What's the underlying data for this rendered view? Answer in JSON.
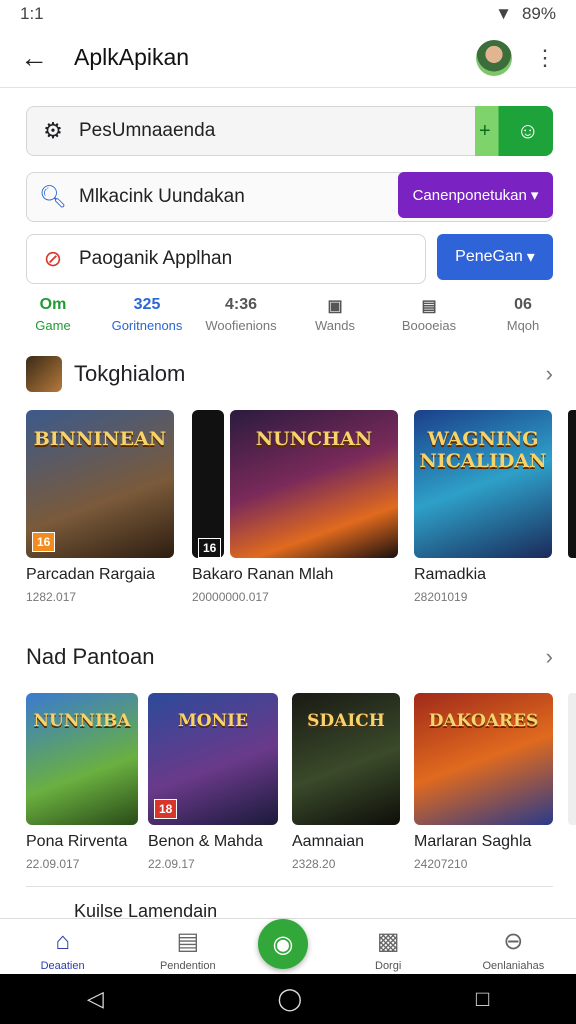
{
  "status_bar": {
    "time": "1:1",
    "battery": "89%"
  },
  "app_bar": {
    "title": "AplkApikan"
  },
  "search_rows": [
    {
      "text": "PesUmnaaenda",
      "icon": "gear-icon"
    },
    {
      "text": "Mlkacink Uundakan",
      "icon": "search-icon"
    },
    {
      "text": "Paoganik Applhan",
      "icon": "no-entry-icon"
    }
  ],
  "buttons": {
    "purple_label": "Canenponetukan",
    "blue_label": "PeneGan"
  },
  "stats": [
    {
      "value": "Om",
      "label": "Game"
    },
    {
      "value": "325",
      "label": "Goritnenons"
    },
    {
      "value": "4:36",
      "label": "Woofienions"
    },
    {
      "value": "",
      "label": "Wands"
    },
    {
      "value": "",
      "label": "Boooeias"
    },
    {
      "value": "06",
      "label": "Mqoh"
    }
  ],
  "section1": {
    "title": "Tokghialom",
    "cards": [
      {
        "art_title": "BINNINEAN",
        "rating": "16",
        "name": "Parcadan Rargaia",
        "meta": "1282.017"
      },
      {
        "art_title": "NUNCHAN",
        "rating": "16",
        "name": "Bakaro Ranan Mlah",
        "meta": "20000000.017"
      },
      {
        "art_title": "WAGNING NICALIDAN",
        "rating": "",
        "name": "Ramadkia",
        "meta": "28201019"
      }
    ]
  },
  "section2": {
    "title": "Nad Pantoan",
    "cards": [
      {
        "art_title": "NUNNIBA",
        "rating": "",
        "name": "Pona Rirventa",
        "meta": "22.09.017"
      },
      {
        "art_title": "MONIE",
        "rating": "18",
        "name": "Benon & Mahda",
        "meta": "22.09.17"
      },
      {
        "art_title": "SDAICH",
        "rating": "",
        "name": "Aamnaian",
        "meta": "2328.20"
      },
      {
        "art_title": "DAKOARES",
        "rating": "",
        "name": "Marlaran Saghla",
        "meta": "24207210"
      }
    ]
  },
  "section3": {
    "title": "Kuilse Lamendain"
  },
  "bottom_nav": [
    {
      "label": "Deaatien"
    },
    {
      "label": "Pendention"
    },
    {
      "label": "Dorgi"
    },
    {
      "label": "Oenlaniahas"
    }
  ]
}
